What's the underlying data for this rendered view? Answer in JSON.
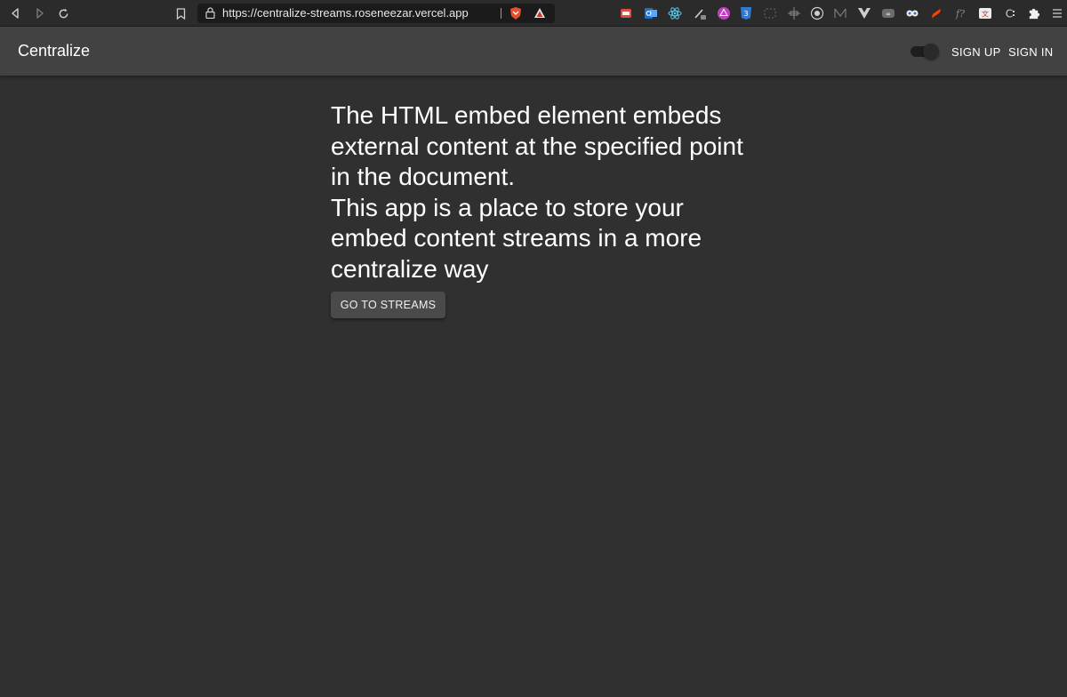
{
  "browser": {
    "url": "https://centralize-streams.roseneezar.vercel.app",
    "nav_icons": [
      "back-icon",
      "forward-icon",
      "reload-icon",
      "bookmark-icon",
      "lock-icon"
    ],
    "extension_icons": [
      "brave-shield-icon",
      "brave-rewards-icon",
      "extension-icons"
    ]
  },
  "app_bar": {
    "title": "Centralize",
    "theme_toggle": "dark-mode-toggle",
    "sign_up_label": "SIGN UP",
    "sign_in_label": "SIGN IN"
  },
  "main": {
    "paragraph_1": "The HTML embed element embeds external content at the specified point in the document.",
    "paragraph_2": "This app is a place to store your embed content streams in a more centralize way",
    "cta_label": "GO TO STREAMS"
  },
  "colors": {
    "page_background": "#303030",
    "app_bar_background": "#424242",
    "text_primary": "#ffffff",
    "button_background": "#4a4a4a"
  }
}
